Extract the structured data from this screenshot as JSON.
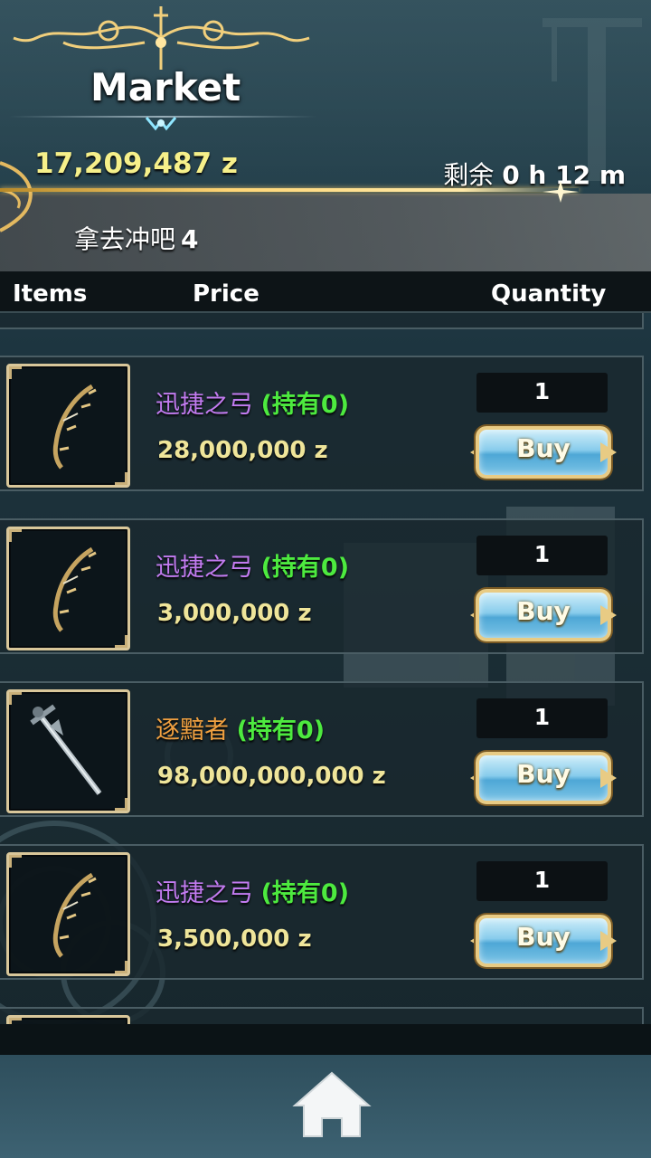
{
  "header": {
    "title": "Market",
    "balance": "17,209,487 z",
    "timer_prefix": "剩余",
    "timer_value": "0 h 12 m",
    "subbar_text": "拿去冲吧",
    "subbar_count": "4"
  },
  "columns": {
    "items": "Items",
    "price": "Price",
    "quantity": "Quantity"
  },
  "items": [
    {
      "name": "迅捷之弓",
      "owned": "(持有0)",
      "price": "28,000,000 z",
      "quantity": "1",
      "buy_label": "Buy",
      "icon": "bow-icon",
      "name_color": "#c27bf0"
    },
    {
      "name": "迅捷之弓",
      "owned": "(持有0)",
      "price": "3,000,000 z",
      "quantity": "1",
      "buy_label": "Buy",
      "icon": "bow-icon",
      "name_color": "#c27bf0"
    },
    {
      "name": "逐黯者",
      "owned": "(持有0)",
      "price": "98,000,000,000 z",
      "quantity": "1",
      "buy_label": "Buy",
      "icon": "dagger-icon",
      "name_color": "#f0a040"
    },
    {
      "name": "迅捷之弓",
      "owned": "(持有0)",
      "price": "3,500,000 z",
      "quantity": "1",
      "buy_label": "Buy",
      "icon": "bow-icon",
      "name_color": "#c27bf0"
    }
  ],
  "colors": {
    "balance": "#f6f08a",
    "owned": "#4dea3f",
    "price": "#efe59a",
    "gold_accent": "#e8cb84"
  }
}
